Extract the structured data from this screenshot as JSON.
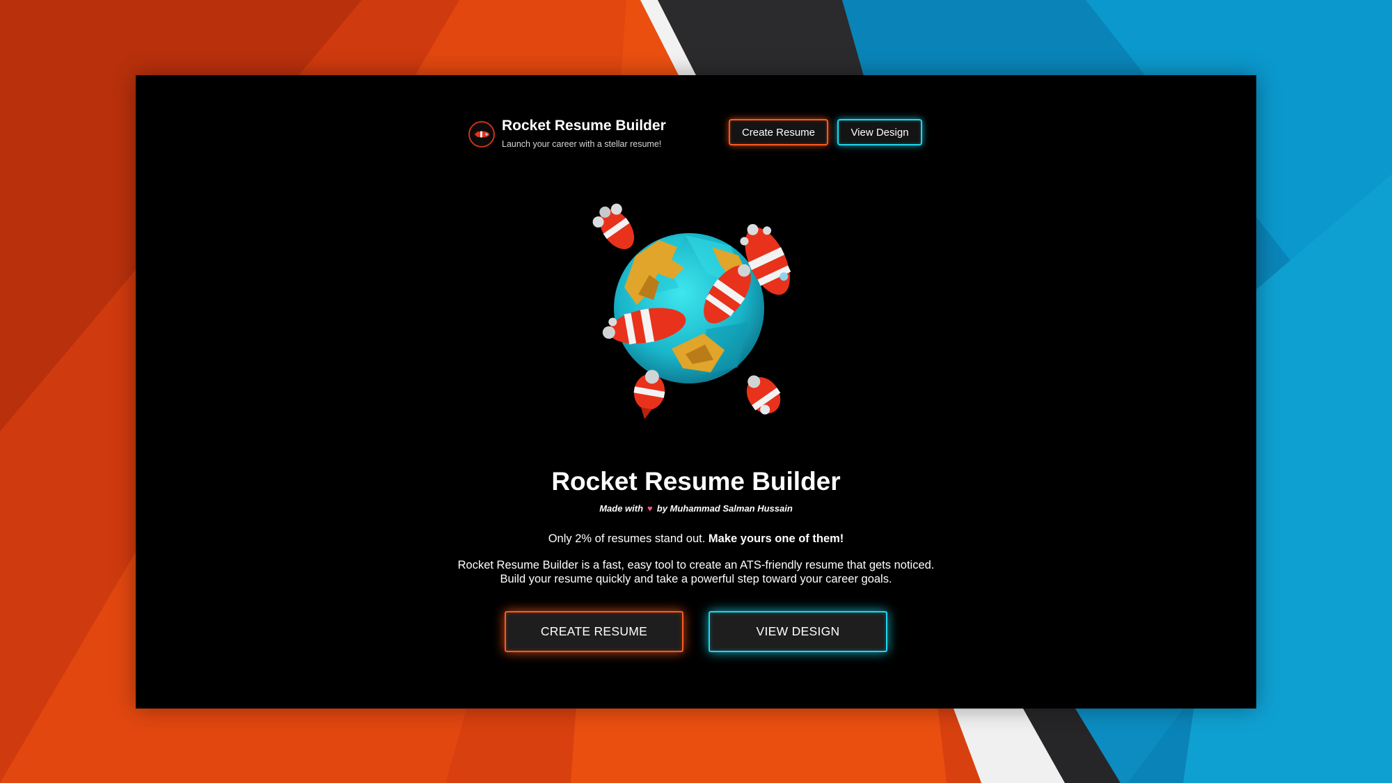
{
  "colors": {
    "accent_orange": "#ff5a1f",
    "accent_cyan": "#1ed8f0",
    "window_bg": "#000000",
    "heart": "#ff4f8b"
  },
  "header": {
    "logo_icon": "rocket-icon",
    "title": "Rocket Resume Builder",
    "tagline": "Launch your career with a stellar resume!",
    "create_label": "Create Resume",
    "view_label": "View Design"
  },
  "hero": {
    "illustration_icon": "globe-with-rockets-illustration",
    "title": "Rocket Resume Builder",
    "credit_prefix": "Made with",
    "heart_icon": "heart-icon",
    "credit_suffix": "by Muhammad Salman Hussain",
    "stat_text": "Only 2% of resumes stand out.",
    "stat_emphasis": "Make yours one of them!",
    "desc_line1": "Rocket Resume Builder is a fast, easy tool to create an ATS-friendly resume that gets noticed.",
    "desc_line2": "Build your resume quickly and take a powerful step toward your career goals.",
    "create_label": "CREATE RESUME",
    "view_label": "VIEW DESIGN"
  }
}
